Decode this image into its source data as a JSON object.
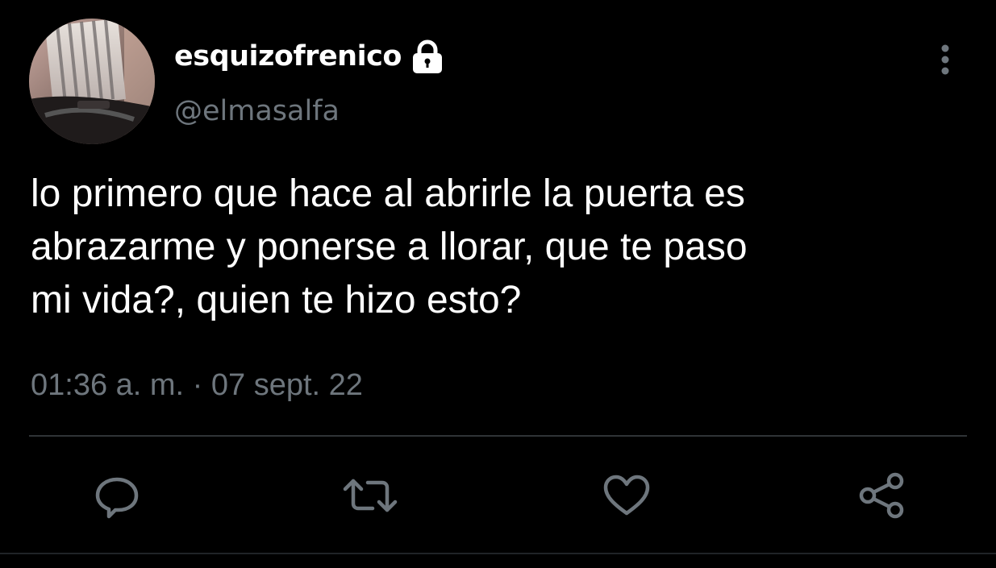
{
  "user": {
    "display_name": "esquizofrenico",
    "handle": "@elmasalfa",
    "protected_icon": "lock-icon",
    "avatar_icon": "profile-photo"
  },
  "tweet": {
    "text_lines": [
      "lo primero que hace al abrirle la puerta es",
      "abrazarme y ponerse a llorar, que te paso",
      "mi vida?, quien te hizo esto?"
    ],
    "timestamp": "01:36 a. m. · 07 sept. 22"
  },
  "actions": {
    "more": "more-vertical-icon",
    "reply": "reply-icon",
    "retweet": "retweet-icon",
    "like": "heart-icon",
    "share": "share-icon"
  },
  "colors": {
    "background": "#000000",
    "text": "#ffffff",
    "secondary": "#6e767d",
    "divider": "#2f3336"
  }
}
